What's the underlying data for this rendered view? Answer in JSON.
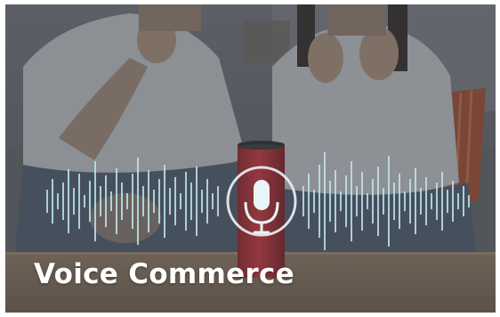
{
  "hero": {
    "title": "Voice Commerce",
    "icon": "microphone-icon"
  },
  "colors": {
    "overlay": "#3b3e44",
    "speaker": "#b8333b",
    "wave": "#bfe6ec",
    "title": "#ffffff"
  }
}
